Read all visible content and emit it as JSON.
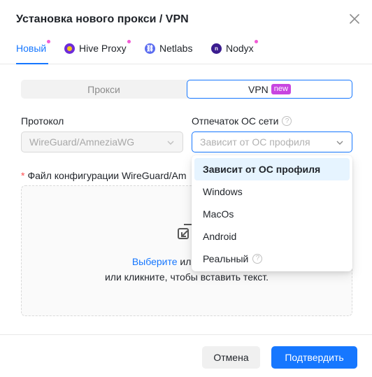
{
  "modal": {
    "title": "Установка нового прокси / VPN"
  },
  "tabs": [
    {
      "label": "Новый"
    },
    {
      "label": "Hive Proxy"
    },
    {
      "label": "Netlabs"
    },
    {
      "label": "Nodyx"
    }
  ],
  "segmented": {
    "proxy_label": "Прокси",
    "vpn_label": "VPN",
    "vpn_badge": "new"
  },
  "form": {
    "protocol_label": "Протокол",
    "protocol_value": "WireGuard/AmneziaWG",
    "fingerprint_label": "Отпечаток ОС сети",
    "fingerprint_placeholder": "Зависит от ОС профиля",
    "config_label": "Файл конфигурации WireGuard/Am"
  },
  "dropzone": {
    "link_text": "Выберите",
    "line1_rest": " или перетяни",
    "line2": "или кликните, чтобы вставить текст."
  },
  "dropdown_options": [
    {
      "label": "Зависит от ОС профиля"
    },
    {
      "label": "Windows"
    },
    {
      "label": "MacOs"
    },
    {
      "label": "Android"
    },
    {
      "label": "Реальный"
    }
  ],
  "footer": {
    "cancel_label": "Отмена",
    "confirm_label": "Подтвердить"
  },
  "colors": {
    "accent": "#1677ff",
    "badge": "#c845e0",
    "tab_dot": "#f25bd6"
  }
}
